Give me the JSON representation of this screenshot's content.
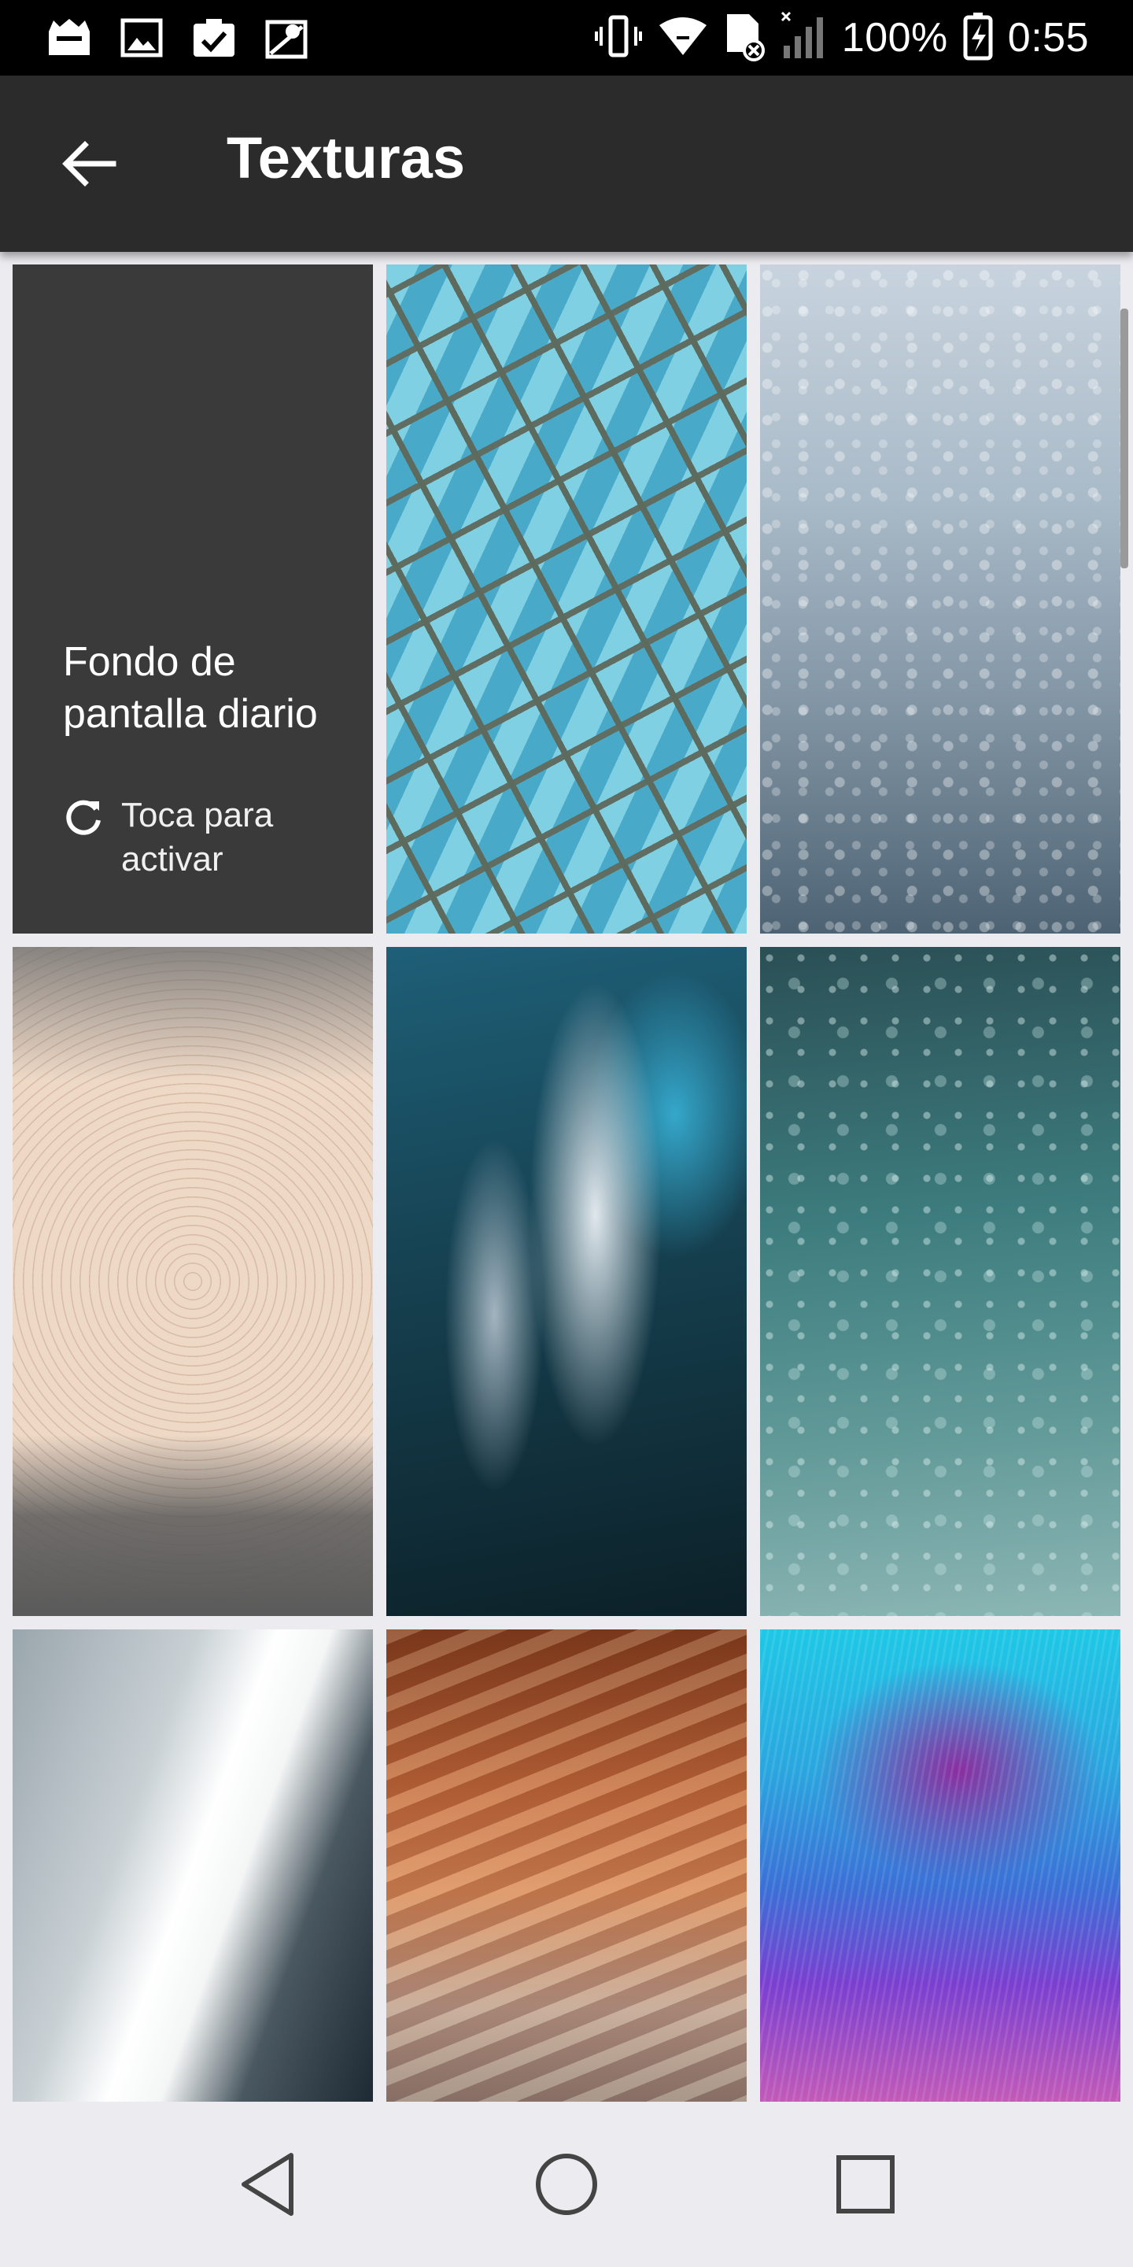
{
  "status_bar": {
    "battery_percent": "100%",
    "time": "0:55",
    "left_icons": [
      "notification-app-icon",
      "image-icon",
      "clipboard-check-icon",
      "map-icon"
    ],
    "right_icons": [
      "vibrate-icon",
      "wifi-icon",
      "sim-off-icon",
      "signal-icon",
      "battery-charging-icon"
    ]
  },
  "app_bar": {
    "title": "Texturas",
    "back_icon": "arrow-back-icon"
  },
  "grid": {
    "daily_tile": {
      "title": "Fondo de pantalla diario",
      "action_label": "Toca para activar",
      "action_icon": "refresh-icon"
    },
    "wallpapers": [
      "glass-building-texture",
      "frost-texture",
      "wood-rings-texture",
      "ice-cave-texture",
      "underwater-texture",
      "building-perspective-texture",
      "canyon-texture",
      "peacock-feather-texture"
    ]
  },
  "nav_bar": {
    "buttons": [
      "back-triangle-icon",
      "home-circle-icon",
      "recents-square-icon"
    ]
  },
  "colors": {
    "status_bar": "#000000",
    "app_bar": "#2b2b2b",
    "daily_tile": "#3a3a3a",
    "background": "#ececf0"
  }
}
